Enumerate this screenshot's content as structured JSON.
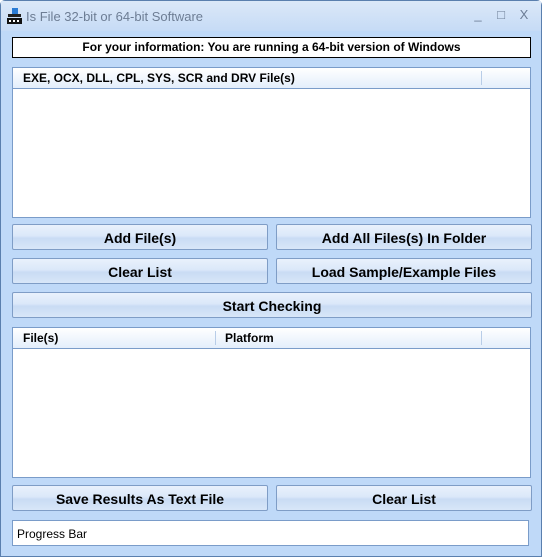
{
  "window": {
    "title": "Is File 32-bit or 64-bit Software",
    "controls": {
      "minimize": "_",
      "maximize": "□",
      "close": "X"
    }
  },
  "info_banner": "For your information: You are running a 64-bit version of Windows",
  "input_list": {
    "columns": [
      "EXE, OCX, DLL, CPL, SYS, SCR and DRV File(s)"
    ],
    "rows": []
  },
  "buttons": {
    "add_files": "Add File(s)",
    "add_folder": "Add All Files(s) In Folder",
    "clear_list_top": "Clear List",
    "load_sample": "Load Sample/Example Files",
    "start_checking": "Start Checking",
    "save_results": "Save Results As Text File",
    "clear_list_bottom": "Clear List"
  },
  "results_list": {
    "columns": [
      "File(s)",
      "Platform"
    ],
    "rows": []
  },
  "progress_bar": {
    "label": "Progress Bar"
  },
  "icons": {
    "app": "app-icon",
    "minimize": "minimize-icon",
    "maximize": "maximize-icon",
    "close": "close-icon"
  }
}
